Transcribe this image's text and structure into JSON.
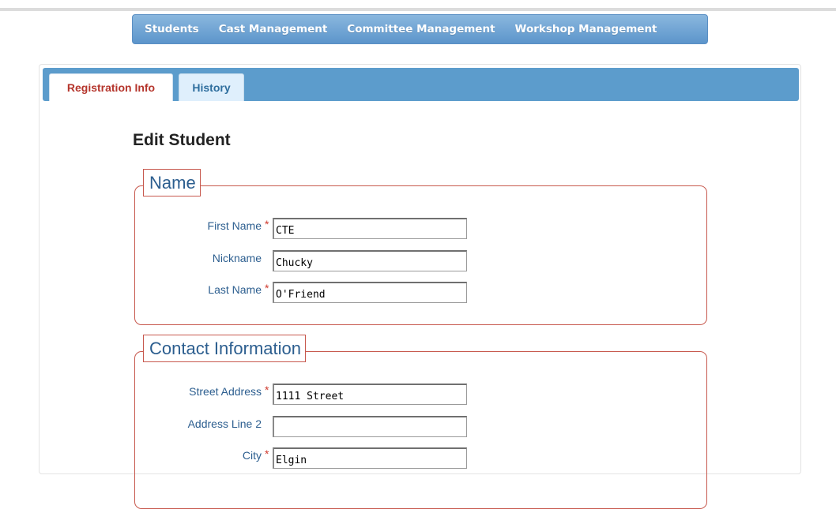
{
  "nav": {
    "items": [
      "Students",
      "Cast Management",
      "Committee Management",
      "Workshop Management"
    ]
  },
  "tabs": [
    {
      "label": "Registration Info",
      "active": true
    },
    {
      "label": "History",
      "active": false
    }
  ],
  "page": {
    "title": "Edit Student"
  },
  "colors": {
    "nav_bar": "#6ea3d3",
    "tab_bar": "#5c9ccc",
    "fieldset_border": "#c7584d",
    "label_text": "#2c5e8f",
    "required_marker": "#d03a2e",
    "active_tab_text": "#b5352c"
  },
  "sections": {
    "name": {
      "legend": "Name",
      "fields": [
        {
          "label": "First Name",
          "required_marker": "*",
          "value": "CTE"
        },
        {
          "label": "Nickname",
          "value": "Chucky"
        },
        {
          "label": "Last Name",
          "required_marker": "*",
          "value": "O'Friend"
        }
      ]
    },
    "contact": {
      "legend": "Contact Information",
      "fields": [
        {
          "label": "Street Address",
          "required_marker": "*",
          "value": "1111 Street"
        },
        {
          "label": "Address Line 2",
          "value": ""
        },
        {
          "label": "City",
          "required_marker": "*",
          "value": "Elgin"
        }
      ]
    }
  }
}
